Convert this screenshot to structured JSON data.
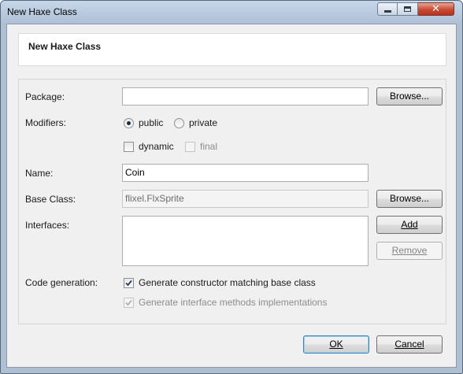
{
  "window": {
    "title": "New Haxe Class",
    "controls": {
      "minimize": "minimize-icon",
      "maximize": "maximize-icon",
      "close": "close-icon"
    }
  },
  "header": {
    "title": "New Haxe Class"
  },
  "form": {
    "package": {
      "label": "Package:",
      "value": "",
      "browse_label": "Browse..."
    },
    "modifiers": {
      "label": "Modifiers:",
      "public_label": "public",
      "public_selected": true,
      "private_label": "private",
      "private_selected": false,
      "dynamic_label": "dynamic",
      "dynamic_checked": false,
      "final_label": "final",
      "final_checked": false,
      "final_enabled": false
    },
    "name": {
      "label": "Name:",
      "value": "Coin"
    },
    "base_class": {
      "label": "Base Class:",
      "value": "flixel.FlxSprite",
      "browse_label": "Browse..."
    },
    "interfaces": {
      "label": "Interfaces:",
      "add_label": "Add",
      "remove_label": "Remove",
      "remove_enabled": false
    },
    "code_generation": {
      "label": "Code generation:",
      "constructor_label": "Generate constructor matching base class",
      "constructor_checked": true,
      "interface_methods_label": "Generate interface methods implementations",
      "interface_methods_checked": true,
      "interface_methods_enabled": false
    }
  },
  "footer": {
    "ok_label": "OK",
    "cancel_label": "Cancel"
  }
}
